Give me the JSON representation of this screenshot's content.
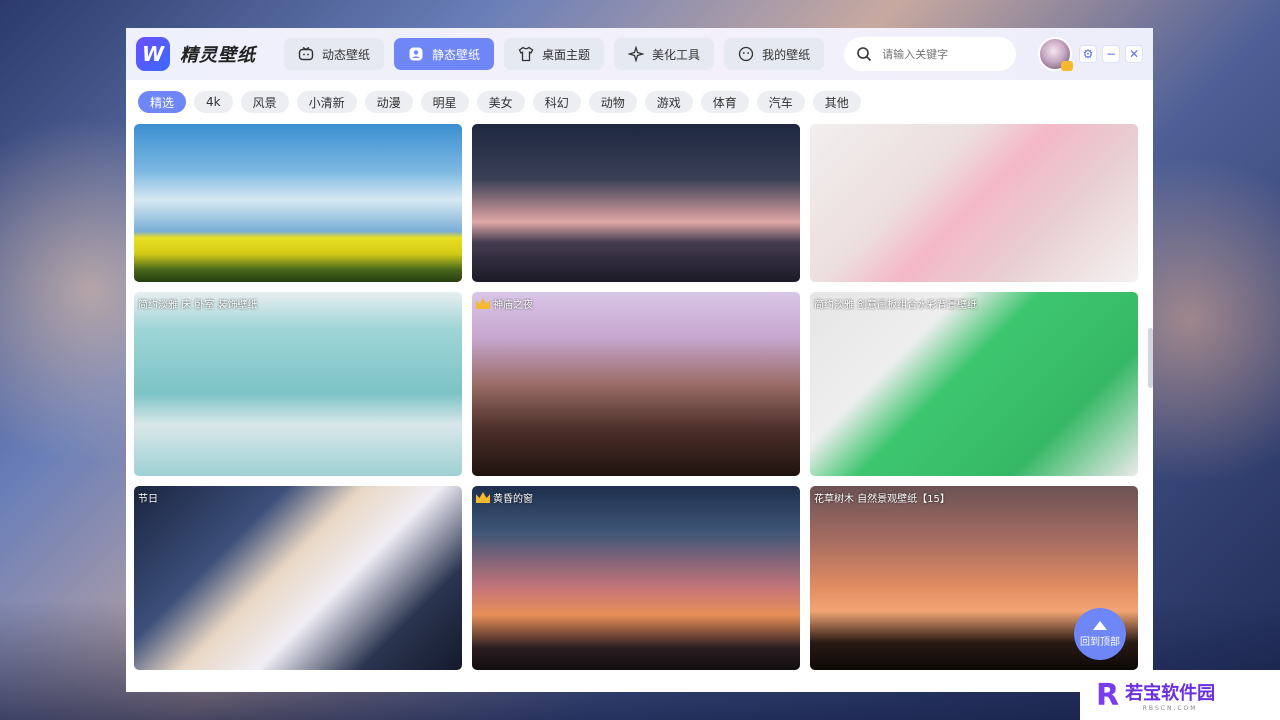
{
  "app": {
    "logo_letter": "W",
    "title": "精灵壁纸"
  },
  "nav_tabs": [
    {
      "label": "动态壁纸",
      "icon": "tv-icon",
      "active": false
    },
    {
      "label": "静态壁纸",
      "icon": "image-icon",
      "active": true
    },
    {
      "label": "桌面主题",
      "icon": "shirt-icon",
      "active": false
    },
    {
      "label": "美化工具",
      "icon": "sparkle-icon",
      "active": false
    },
    {
      "label": "我的壁纸",
      "icon": "smile-icon",
      "active": false
    }
  ],
  "search": {
    "placeholder": "请输入关键字"
  },
  "window_controls": {
    "settings": "⚙",
    "minimize": "−",
    "close": "✕"
  },
  "categories": [
    "精选",
    "4k",
    "风景",
    "小清新",
    "动漫",
    "明星",
    "美女",
    "科幻",
    "动物",
    "游戏",
    "体育",
    "汽车",
    "其他"
  ],
  "active_category": "精选",
  "wallpapers": [
    {
      "title": "",
      "premium": false
    },
    {
      "title": "",
      "premium": false
    },
    {
      "title": "",
      "premium": false
    },
    {
      "title": "简约淡雅 床 卧室 装饰壁纸",
      "premium": false
    },
    {
      "title": "神庙之夜",
      "premium": true
    },
    {
      "title": "简约淡雅 创意画板组合水彩背景壁纸",
      "premium": false
    },
    {
      "title": "节日",
      "premium": false
    },
    {
      "title": "黄昏的窗",
      "premium": true
    },
    {
      "title": "花草树木 自然景观壁纸【15】",
      "premium": false
    }
  ],
  "back_to_top": {
    "label": "回到顶部"
  },
  "watermark": {
    "logo": "R",
    "title": "若宝软件园",
    "sub": "RBSCN.COM"
  }
}
